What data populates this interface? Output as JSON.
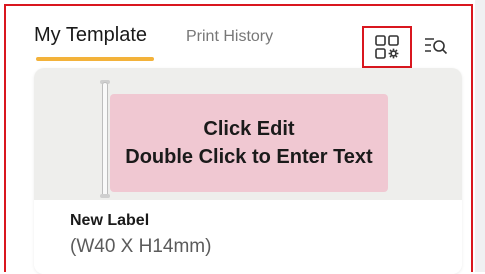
{
  "tabs": [
    {
      "label": "My Template",
      "active": true
    },
    {
      "label": "Print History",
      "active": false
    }
  ],
  "toolbar": {
    "grid_icon": "template-grid-settings-icon",
    "search_icon": "list-search-icon"
  },
  "template_card": {
    "label_lines": [
      "Click Edit",
      "Double Click to Enter Text"
    ],
    "name": "New Label",
    "size": "(W40 X H14mm)"
  },
  "colors": {
    "highlight": "#d9171f",
    "tab_accent": "#f3b23a",
    "label_fill": "#f0c8d2"
  }
}
